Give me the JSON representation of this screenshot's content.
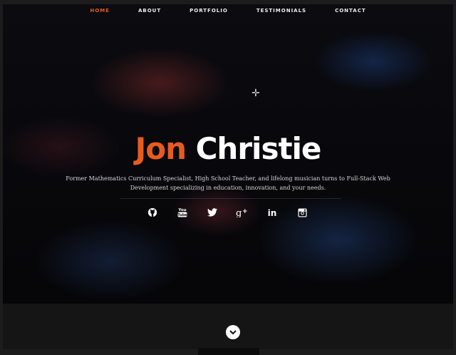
{
  "nav": {
    "items": [
      {
        "label": "HOME",
        "active": true
      },
      {
        "label": "ABOUT"
      },
      {
        "label": "PORTFOLIO"
      },
      {
        "label": "TESTIMONIALS"
      },
      {
        "label": "CONTACT"
      }
    ]
  },
  "hero": {
    "first_name": "Jon",
    "last_name": "Christie",
    "tagline": "Former Mathematics Curriculum Specialist, High School Teacher, and lifelong musician turns to Full-Stack Web Development specializing in education, innovation, and your needs."
  },
  "social": [
    "github-icon",
    "youtube-icon",
    "twitter-icon",
    "google-plus-icon",
    "linkedin-icon",
    "instagram-icon"
  ],
  "colors": {
    "accent": "#e65c1e",
    "background": "#070709",
    "text": "#ffffff"
  }
}
